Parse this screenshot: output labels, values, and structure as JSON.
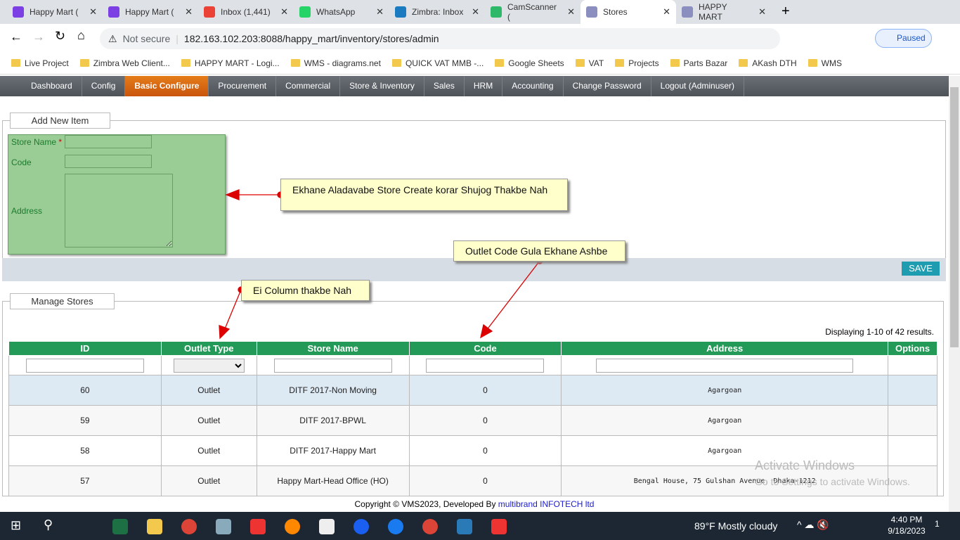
{
  "browser": {
    "tabs": [
      {
        "title": "Happy Mart (",
        "color": "#7b3fe4"
      },
      {
        "title": "Happy Mart (",
        "color": "#7b3fe4"
      },
      {
        "title": "Inbox (1,441)",
        "color": "#ea4335"
      },
      {
        "title": "WhatsApp",
        "color": "#25d366"
      },
      {
        "title": "Zimbra: Inbox",
        "color": "#1a7bc0"
      },
      {
        "title": "CamScanner (",
        "color": "#2db86a"
      },
      {
        "title": "Stores",
        "color": "#8a8fbf"
      },
      {
        "title": "HAPPY MART",
        "color": "#8a8fbf"
      }
    ],
    "not_secure": "Not secure",
    "url": "182.163.102.203:8088/happy_mart/inventory/stores/admin",
    "profile": "Paused",
    "bookmarks": [
      "Live Project",
      "Zimbra Web Client...",
      "HAPPY MART - Logi...",
      "WMS - diagrams.net",
      "QUICK VAT MMB -...",
      "Google Sheets",
      "VAT",
      "Projects",
      "Parts Bazar",
      "AKash DTH",
      "WMS"
    ]
  },
  "menu": [
    "Dashboard",
    "Config",
    "Basic Configure",
    "Procurement",
    "Commercial",
    "Store & Inventory",
    "Sales",
    "HRM",
    "Accounting",
    "Change Password",
    "Logout (Adminuser)"
  ],
  "add_form": {
    "legend": "Add New Item",
    "store_name": "Store Name",
    "required": "*",
    "code": "Code",
    "address": "Address",
    "save": "SAVE"
  },
  "manage": {
    "legend": "Manage Stores",
    "summary": "Displaying 1-10 of 42 results.",
    "columns": [
      "ID",
      "Outlet Type",
      "Store Name",
      "Code",
      "Address",
      "Options"
    ],
    "rows": [
      {
        "id": "60",
        "type": "Outlet",
        "name": "DITF 2017-Non Moving",
        "code": "0",
        "address": "Agargoan"
      },
      {
        "id": "59",
        "type": "Outlet",
        "name": "DITF 2017-BPWL",
        "code": "0",
        "address": "Agargoan"
      },
      {
        "id": "58",
        "type": "Outlet",
        "name": "DITF 2017-Happy Mart",
        "code": "0",
        "address": "Agargoan"
      },
      {
        "id": "57",
        "type": "Outlet",
        "name": "Happy Mart-Head Office (HO)",
        "code": "0",
        "address": "Bengal House, 75 Gulshan Avenue, Dhaka-1212"
      }
    ]
  },
  "callouts": {
    "store_create": "Ekhane Aladavabe Store Create korar Shujog Thakbe Nah",
    "outlet_code": "Outlet Code Gula Ekhane Ashbe",
    "column": "Ei Column thakbe Nah"
  },
  "footer": {
    "copyright": "Copyright © VMS2023, Developed By ",
    "company": "multibrand INFOTECH ltd"
  },
  "watermark": {
    "title": "Activate Windows",
    "sub": "Go to Settings to activate Windows."
  },
  "taskbar": {
    "weather": "89°F  Mostly cloudy",
    "time": "4:40 PM",
    "date": "9/18/2023",
    "notif": "1"
  }
}
